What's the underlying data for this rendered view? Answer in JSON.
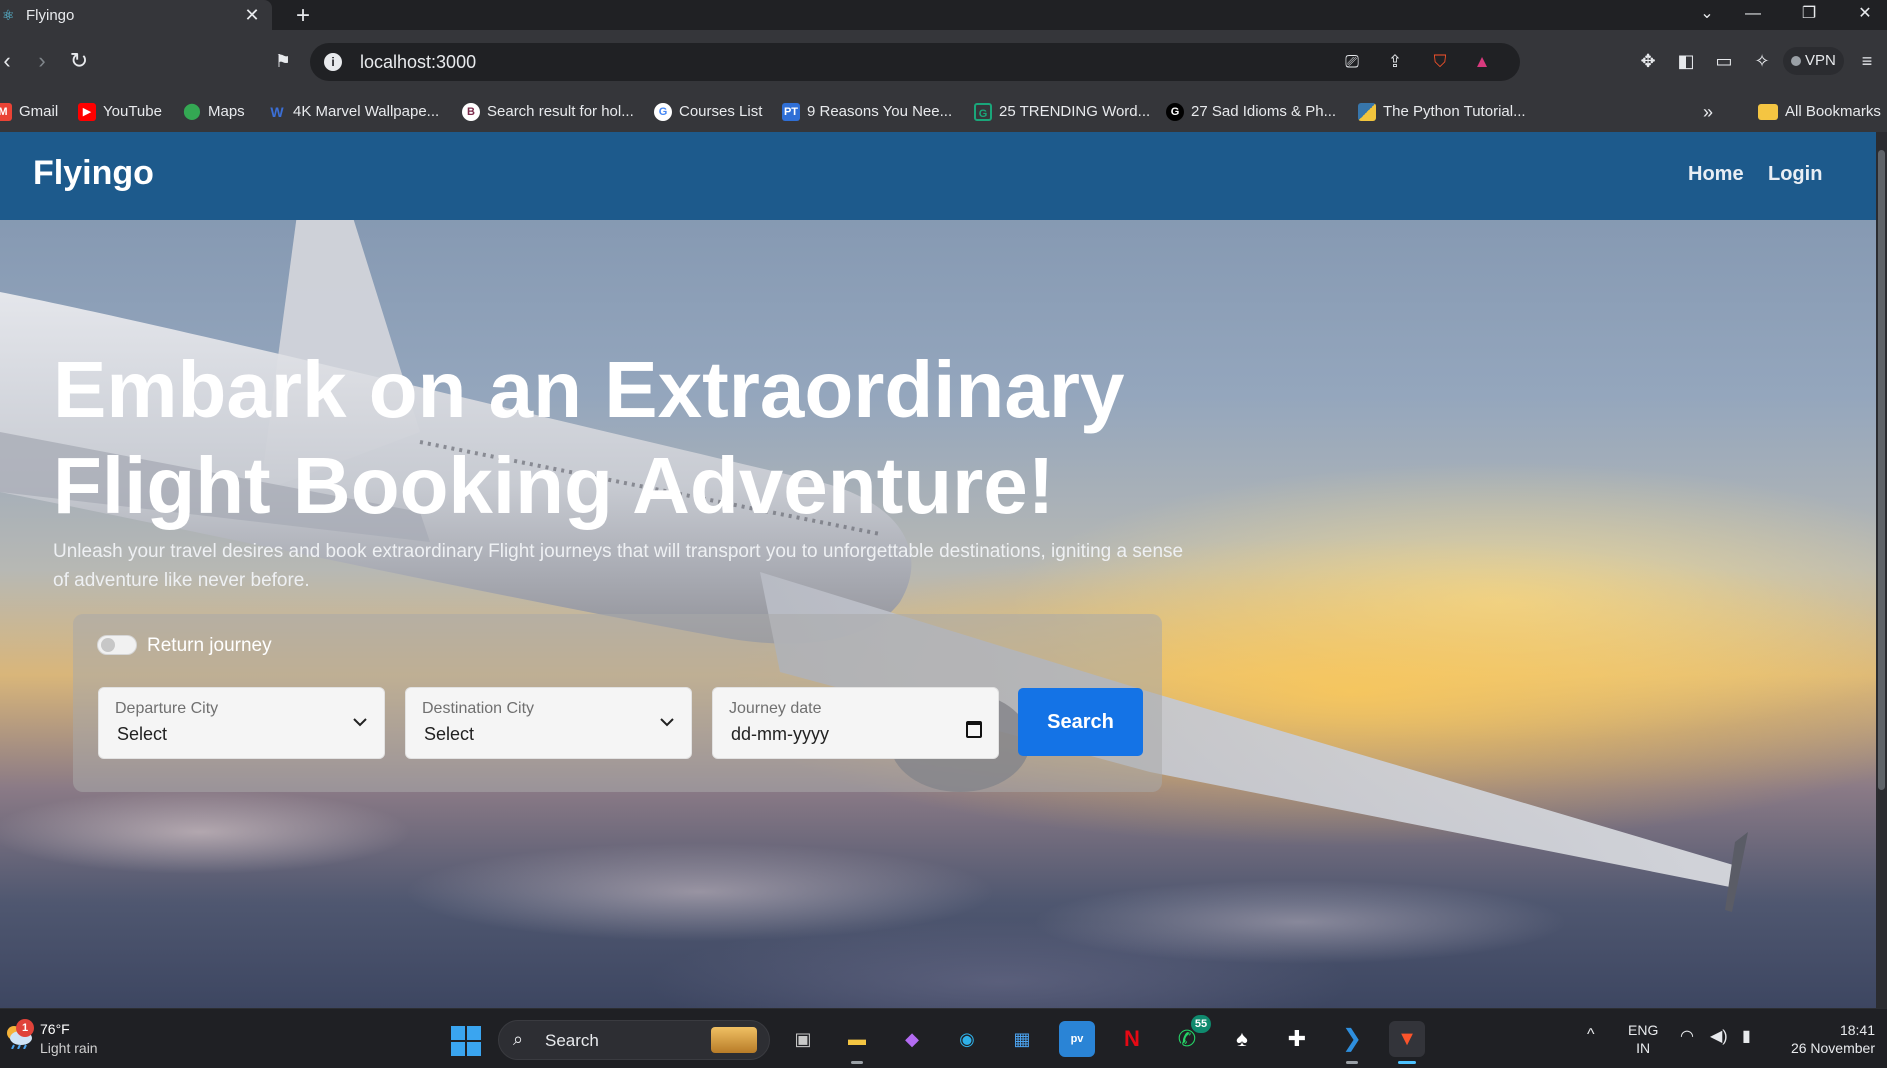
{
  "browser": {
    "tab_title": "Flyingo",
    "tab_close": "✕",
    "new_tab": "+",
    "url": "localhost:3000",
    "vpn_label": "VPN",
    "window_controls": {
      "dropdown": "⌄",
      "minimize": "—",
      "restore": "❐",
      "close": "✕"
    },
    "bookmarks": [
      {
        "label": "Gmail",
        "icon": "gmail-icon",
        "color": "#ea4335"
      },
      {
        "label": "YouTube",
        "icon": "youtube-icon",
        "color": "#ff0000"
      },
      {
        "label": "Maps",
        "icon": "maps-icon",
        "color": "#34a853"
      },
      {
        "label": "4K Marvel Wallpape...",
        "icon": "wallpaper-icon",
        "color": "#3b6fd6"
      },
      {
        "label": "Search result for hol...",
        "icon": "search-result-icon",
        "color": "#ffffff"
      },
      {
        "label": "Courses List",
        "icon": "google-icon",
        "color": "#4285f4"
      },
      {
        "label": "9 Reasons You Nee...",
        "icon": "pt-icon",
        "color": "#2f6fd6"
      },
      {
        "label": "25 TRENDING Word...",
        "icon": "grammar-icon",
        "color": "#1aa67a"
      },
      {
        "label": "27 Sad Idioms & Ph...",
        "icon": "g-icon",
        "color": "#000000"
      },
      {
        "label": "The Python Tutorial...",
        "icon": "python-icon",
        "color": "#f2c53d"
      }
    ],
    "bookmarks_overflow": "»",
    "all_bookmarks": "All Bookmarks"
  },
  "page": {
    "brand": "Flyingo",
    "nav": {
      "home": "Home",
      "login": "Login"
    },
    "hero": {
      "title_line1": "Embark on an Extraordinary",
      "title_line2": "Flight Booking Adventure!",
      "subtitle": "Unleash your travel desires and book extraordinary Flight journeys that will transport you to unforgettable destinations, igniting a sense of adventure like never before."
    },
    "search_form": {
      "return_journey_label": "Return journey",
      "return_journey_on": false,
      "departure": {
        "label": "Departure City",
        "value": "Select"
      },
      "destination": {
        "label": "Destination City",
        "value": "Select"
      },
      "journey_date": {
        "label": "Journey date",
        "value": "dd-mm-yyyy"
      },
      "search_button": "Search"
    }
  },
  "taskbar": {
    "weather": {
      "badge": "1",
      "temp": "76°F",
      "desc": "Light rain"
    },
    "search_placeholder": "Search",
    "apps": [
      {
        "name": "task-view",
        "glyph": "▣",
        "color": "#c9c9c9"
      },
      {
        "name": "file-explorer",
        "glyph": "▬",
        "color": "#f4c542"
      },
      {
        "name": "copilot",
        "glyph": "◆",
        "color": "#b36bf2"
      },
      {
        "name": "edge",
        "glyph": "◉",
        "color": "#2fb0e8"
      },
      {
        "name": "microsoft-store",
        "glyph": "▦",
        "color": "#4ba3f0"
      },
      {
        "name": "prime-video",
        "glyph": "pv",
        "color": "#2a84d6"
      },
      {
        "name": "netflix",
        "glyph": "N",
        "color": "#e50914"
      },
      {
        "name": "whatsapp",
        "glyph": "✆",
        "color": "#25d366",
        "badge": "55"
      },
      {
        "name": "solitaire",
        "glyph": "♠",
        "color": "#ffffff"
      },
      {
        "name": "puzzle",
        "glyph": "✚",
        "color": "#ffffff"
      },
      {
        "name": "vscode",
        "glyph": "❯",
        "color": "#2e8fde"
      },
      {
        "name": "brave",
        "glyph": "▼",
        "color": "#fb542b"
      }
    ],
    "tray_chevron": "^",
    "lang_line1": "ENG",
    "lang_line2": "IN",
    "time": "18:41",
    "date": "26 November"
  }
}
